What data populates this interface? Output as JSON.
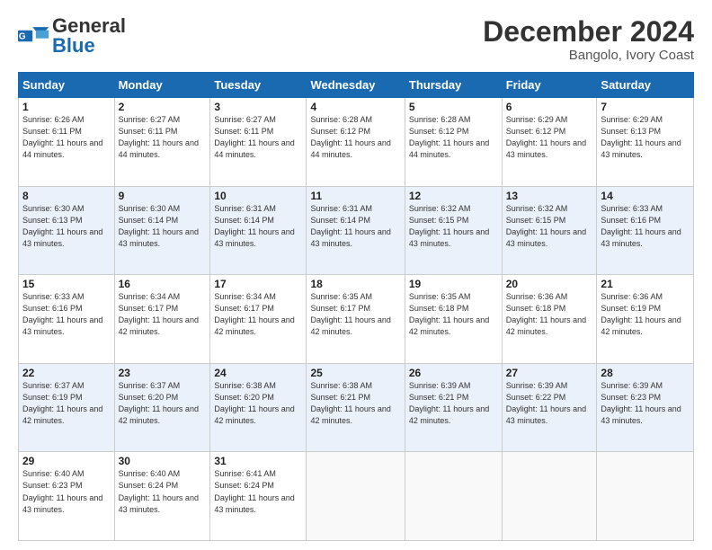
{
  "header": {
    "logo_general": "General",
    "logo_blue": "Blue",
    "month": "December 2024",
    "location": "Bangolo, Ivory Coast"
  },
  "days_of_week": [
    "Sunday",
    "Monday",
    "Tuesday",
    "Wednesday",
    "Thursday",
    "Friday",
    "Saturday"
  ],
  "weeks": [
    [
      {
        "day": "1",
        "sunrise": "6:26 AM",
        "sunset": "6:11 PM",
        "daylight": "11 hours and 44 minutes."
      },
      {
        "day": "2",
        "sunrise": "6:27 AM",
        "sunset": "6:11 PM",
        "daylight": "11 hours and 44 minutes."
      },
      {
        "day": "3",
        "sunrise": "6:27 AM",
        "sunset": "6:11 PM",
        "daylight": "11 hours and 44 minutes."
      },
      {
        "day": "4",
        "sunrise": "6:28 AM",
        "sunset": "6:12 PM",
        "daylight": "11 hours and 44 minutes."
      },
      {
        "day": "5",
        "sunrise": "6:28 AM",
        "sunset": "6:12 PM",
        "daylight": "11 hours and 44 minutes."
      },
      {
        "day": "6",
        "sunrise": "6:29 AM",
        "sunset": "6:12 PM",
        "daylight": "11 hours and 43 minutes."
      },
      {
        "day": "7",
        "sunrise": "6:29 AM",
        "sunset": "6:13 PM",
        "daylight": "11 hours and 43 minutes."
      }
    ],
    [
      {
        "day": "8",
        "sunrise": "6:30 AM",
        "sunset": "6:13 PM",
        "daylight": "11 hours and 43 minutes."
      },
      {
        "day": "9",
        "sunrise": "6:30 AM",
        "sunset": "6:14 PM",
        "daylight": "11 hours and 43 minutes."
      },
      {
        "day": "10",
        "sunrise": "6:31 AM",
        "sunset": "6:14 PM",
        "daylight": "11 hours and 43 minutes."
      },
      {
        "day": "11",
        "sunrise": "6:31 AM",
        "sunset": "6:14 PM",
        "daylight": "11 hours and 43 minutes."
      },
      {
        "day": "12",
        "sunrise": "6:32 AM",
        "sunset": "6:15 PM",
        "daylight": "11 hours and 43 minutes."
      },
      {
        "day": "13",
        "sunrise": "6:32 AM",
        "sunset": "6:15 PM",
        "daylight": "11 hours and 43 minutes."
      },
      {
        "day": "14",
        "sunrise": "6:33 AM",
        "sunset": "6:16 PM",
        "daylight": "11 hours and 43 minutes."
      }
    ],
    [
      {
        "day": "15",
        "sunrise": "6:33 AM",
        "sunset": "6:16 PM",
        "daylight": "11 hours and 43 minutes."
      },
      {
        "day": "16",
        "sunrise": "6:34 AM",
        "sunset": "6:17 PM",
        "daylight": "11 hours and 42 minutes."
      },
      {
        "day": "17",
        "sunrise": "6:34 AM",
        "sunset": "6:17 PM",
        "daylight": "11 hours and 42 minutes."
      },
      {
        "day": "18",
        "sunrise": "6:35 AM",
        "sunset": "6:17 PM",
        "daylight": "11 hours and 42 minutes."
      },
      {
        "day": "19",
        "sunrise": "6:35 AM",
        "sunset": "6:18 PM",
        "daylight": "11 hours and 42 minutes."
      },
      {
        "day": "20",
        "sunrise": "6:36 AM",
        "sunset": "6:18 PM",
        "daylight": "11 hours and 42 minutes."
      },
      {
        "day": "21",
        "sunrise": "6:36 AM",
        "sunset": "6:19 PM",
        "daylight": "11 hours and 42 minutes."
      }
    ],
    [
      {
        "day": "22",
        "sunrise": "6:37 AM",
        "sunset": "6:19 PM",
        "daylight": "11 hours and 42 minutes."
      },
      {
        "day": "23",
        "sunrise": "6:37 AM",
        "sunset": "6:20 PM",
        "daylight": "11 hours and 42 minutes."
      },
      {
        "day": "24",
        "sunrise": "6:38 AM",
        "sunset": "6:20 PM",
        "daylight": "11 hours and 42 minutes."
      },
      {
        "day": "25",
        "sunrise": "6:38 AM",
        "sunset": "6:21 PM",
        "daylight": "11 hours and 42 minutes."
      },
      {
        "day": "26",
        "sunrise": "6:39 AM",
        "sunset": "6:21 PM",
        "daylight": "11 hours and 42 minutes."
      },
      {
        "day": "27",
        "sunrise": "6:39 AM",
        "sunset": "6:22 PM",
        "daylight": "11 hours and 43 minutes."
      },
      {
        "day": "28",
        "sunrise": "6:39 AM",
        "sunset": "6:23 PM",
        "daylight": "11 hours and 43 minutes."
      }
    ],
    [
      {
        "day": "29",
        "sunrise": "6:40 AM",
        "sunset": "6:23 PM",
        "daylight": "11 hours and 43 minutes."
      },
      {
        "day": "30",
        "sunrise": "6:40 AM",
        "sunset": "6:24 PM",
        "daylight": "11 hours and 43 minutes."
      },
      {
        "day": "31",
        "sunrise": "6:41 AM",
        "sunset": "6:24 PM",
        "daylight": "11 hours and 43 minutes."
      },
      null,
      null,
      null,
      null
    ]
  ]
}
